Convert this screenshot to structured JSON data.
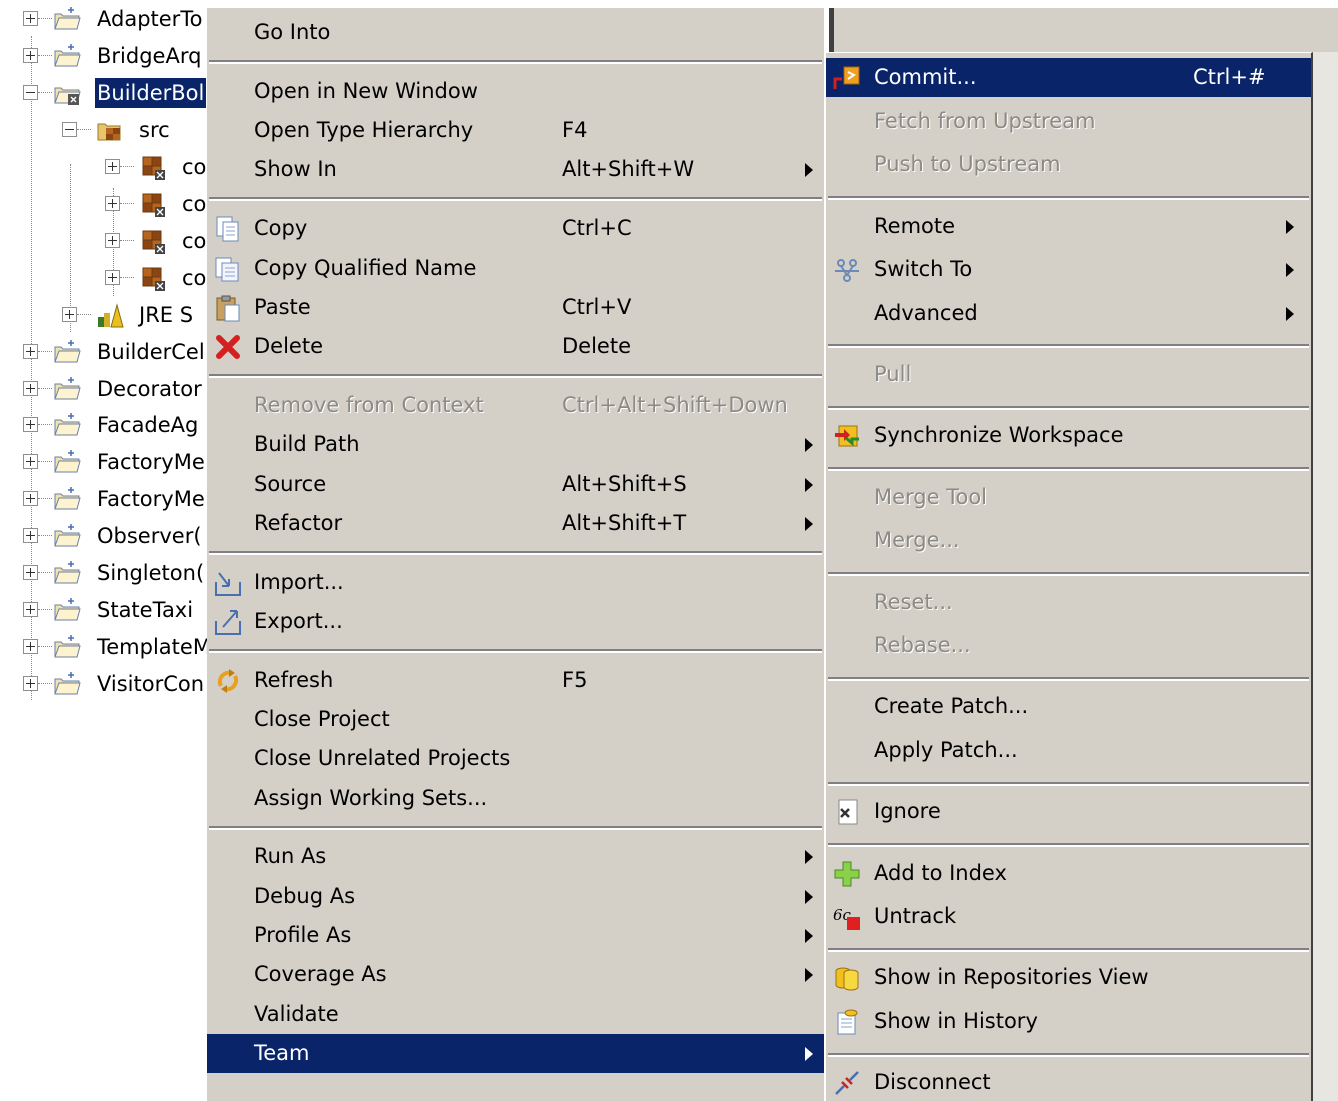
{
  "tree": {
    "items": [
      {
        "label": "AdapterTo",
        "expander": "plus",
        "icon": "project-folder-icon"
      },
      {
        "label": "BridgeArq",
        "expander": "plus",
        "icon": "project-folder-icon"
      },
      {
        "label": "BuilderBol",
        "expander": "minus",
        "icon": "project-folder-git-icon",
        "selected": true
      },
      {
        "label": "src",
        "expander": "minus",
        "icon": "source-folder-icon"
      },
      {
        "label": "co",
        "expander": "plus",
        "icon": "package-icon"
      },
      {
        "label": "co",
        "expander": "plus",
        "icon": "package-icon"
      },
      {
        "label": "co",
        "expander": "plus",
        "icon": "package-icon"
      },
      {
        "label": "co",
        "expander": "plus",
        "icon": "package-icon"
      },
      {
        "label": "JRE S",
        "expander": "plus",
        "icon": "library-icon"
      },
      {
        "label": "BuilderCel",
        "expander": "plus",
        "icon": "project-folder-icon"
      },
      {
        "label": "Decorator",
        "expander": "plus",
        "icon": "project-folder-icon"
      },
      {
        "label": "FacadeAg",
        "expander": "plus",
        "icon": "project-folder-icon"
      },
      {
        "label": "FactoryMe",
        "expander": "plus",
        "icon": "project-folder-icon"
      },
      {
        "label": "FactoryMe",
        "expander": "plus",
        "icon": "project-folder-icon"
      },
      {
        "label": "Observer(",
        "expander": "plus",
        "icon": "project-folder-icon"
      },
      {
        "label": "Singleton(",
        "expander": "plus",
        "icon": "project-folder-icon"
      },
      {
        "label": "StateTaxi",
        "expander": "plus",
        "icon": "project-folder-icon"
      },
      {
        "label": "TemplateM",
        "expander": "plus",
        "icon": "project-folder-icon"
      },
      {
        "label": "VisitorCon",
        "expander": "plus",
        "icon": "project-folder-icon"
      }
    ]
  },
  "context_menu": {
    "items": [
      {
        "label": "Go Into"
      },
      {
        "sep": true
      },
      {
        "label": "Open in New Window"
      },
      {
        "label": "Open Type Hierarchy",
        "accel": "F4"
      },
      {
        "label": "Show In",
        "accel": "Alt+Shift+W",
        "submenu": true
      },
      {
        "sep": true
      },
      {
        "label": "Copy",
        "accel": "Ctrl+C",
        "icon": "copy-icon"
      },
      {
        "label": "Copy Qualified Name",
        "icon": "copy-qualified-name-icon"
      },
      {
        "label": "Paste",
        "accel": "Ctrl+V",
        "icon": "paste-icon"
      },
      {
        "label": "Delete",
        "accel": "Delete",
        "icon": "delete-icon"
      },
      {
        "sep": true
      },
      {
        "label": "Remove from Context",
        "accel": "Ctrl+Alt+Shift+Down",
        "disabled": true
      },
      {
        "label": "Build Path",
        "submenu": true
      },
      {
        "label": "Source",
        "accel": "Alt+Shift+S",
        "submenu": true
      },
      {
        "label": "Refactor",
        "accel": "Alt+Shift+T",
        "submenu": true
      },
      {
        "sep": true
      },
      {
        "label": "Import...",
        "icon": "import-icon"
      },
      {
        "label": "Export...",
        "icon": "export-icon"
      },
      {
        "sep": true
      },
      {
        "label": "Refresh",
        "accel": "F5",
        "icon": "refresh-icon"
      },
      {
        "label": "Close Project"
      },
      {
        "label": "Close Unrelated Projects"
      },
      {
        "label": "Assign Working Sets..."
      },
      {
        "sep": true
      },
      {
        "label": "Run As",
        "submenu": true
      },
      {
        "label": "Debug As",
        "submenu": true
      },
      {
        "label": "Profile As",
        "submenu": true
      },
      {
        "label": "Coverage As",
        "submenu": true
      },
      {
        "label": "Validate"
      },
      {
        "label": "Team",
        "submenu": true,
        "highlighted": true
      }
    ]
  },
  "team_submenu": {
    "items": [
      {
        "label": "Commit...",
        "accel": "Ctrl+#",
        "icon": "commit-icon",
        "highlighted": true
      },
      {
        "label": "Fetch from Upstream",
        "disabled": true
      },
      {
        "label": "Push to Upstream",
        "disabled": true
      },
      {
        "sep": true
      },
      {
        "label": "Remote",
        "submenu": true
      },
      {
        "label": "Switch To",
        "submenu": true,
        "icon": "switch-branch-icon"
      },
      {
        "label": "Advanced",
        "submenu": true
      },
      {
        "sep": true
      },
      {
        "label": "Pull",
        "disabled": true
      },
      {
        "sep": true
      },
      {
        "label": "Synchronize Workspace",
        "icon": "synchronize-icon"
      },
      {
        "sep": true
      },
      {
        "label": "Merge Tool",
        "disabled": true
      },
      {
        "label": "Merge...",
        "disabled": true
      },
      {
        "sep": true
      },
      {
        "label": "Reset...",
        "disabled": true
      },
      {
        "label": "Rebase...",
        "disabled": true
      },
      {
        "sep": true
      },
      {
        "label": "Create Patch..."
      },
      {
        "label": "Apply Patch..."
      },
      {
        "sep": true
      },
      {
        "label": "Ignore",
        "icon": "ignore-icon"
      },
      {
        "sep": true
      },
      {
        "label": "Add to Index",
        "icon": "add-to-index-icon"
      },
      {
        "label": "Untrack",
        "icon": "untrack-icon"
      },
      {
        "sep": true
      },
      {
        "label": "Show in Repositories View",
        "icon": "repositories-view-icon"
      },
      {
        "label": "Show in History",
        "icon": "history-icon"
      },
      {
        "sep": true
      },
      {
        "label": "Disconnect",
        "icon": "disconnect-icon"
      }
    ]
  }
}
